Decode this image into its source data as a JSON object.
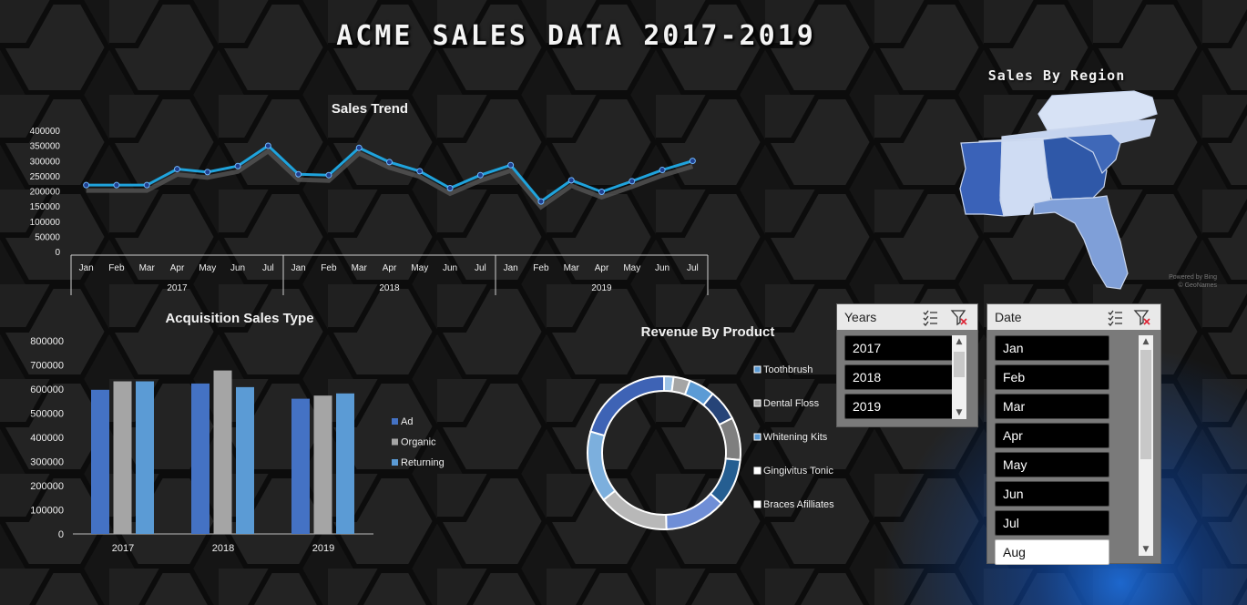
{
  "dashboard": {
    "title": "ACME SALES DATA 2017-2019"
  },
  "colors": {
    "background": "#151515",
    "line": "#1fa3dc",
    "point": "#1f3f8f",
    "ad": "#4472c4",
    "organic": "#a5a5a5",
    "returning": "#5b9bd5"
  },
  "sales_trend": {
    "chart_data": {
      "type": "line",
      "title": "Sales Trend",
      "xlabel": "",
      "ylabel": "",
      "ylim": [
        0,
        400000
      ],
      "yticks": [
        "400000",
        "350000",
        "300000",
        "250000",
        "200000",
        "150000",
        "100000",
        "50000",
        "0"
      ],
      "groups": [
        {
          "label": "2017",
          "months": [
            "Jan",
            "Feb",
            "Mar",
            "Apr",
            "May",
            "Jun",
            "Jul"
          ]
        },
        {
          "label": "2018",
          "months": [
            "Jan",
            "Feb",
            "Mar",
            "Apr",
            "May",
            "Jun",
            "Jul"
          ]
        },
        {
          "label": "2019",
          "months": [
            "Jan",
            "Feb",
            "Mar",
            "Apr",
            "May",
            "Jun",
            "Jul"
          ]
        }
      ],
      "values": [
        222000,
        222000,
        222000,
        275000,
        265000,
        285000,
        352000,
        258000,
        255000,
        345000,
        298000,
        268000,
        212000,
        255000,
        288000,
        168000,
        238000,
        200000,
        235000,
        272000,
        302000
      ]
    }
  },
  "acquisition": {
    "chart_data": {
      "type": "bar",
      "title": "Acquisition Sales Type",
      "categories": [
        "2017",
        "2018",
        "2019"
      ],
      "ylim": [
        0,
        800000
      ],
      "yticks": [
        "800000",
        "700000",
        "600000",
        "500000",
        "400000",
        "300000",
        "200000",
        "100000",
        "0"
      ],
      "series": [
        {
          "name": "Ad",
          "values": [
            597000,
            623000,
            560000
          ]
        },
        {
          "name": "Organic",
          "values": [
            632000,
            677000,
            573000
          ]
        },
        {
          "name": "Returning",
          "values": [
            632000,
            608000,
            582000
          ]
        }
      ],
      "legend_position": "right"
    }
  },
  "revenue": {
    "chart_data": {
      "type": "pie",
      "title": "Revenue By Product",
      "legend": [
        "Toothbrush",
        "Dental Floss",
        "Whitening Kits",
        "Gingivitus Tonic",
        "Braces Afilliates"
      ],
      "slices": [
        {
          "value": 2.0,
          "color": "#9dc3e6"
        },
        {
          "value": 3.5,
          "color": "#a5a5a5"
        },
        {
          "value": 5.5,
          "color": "#5b9bd5"
        },
        {
          "value": 6.5,
          "color": "#264478"
        },
        {
          "value": 9.0,
          "color": "#7f7f7f"
        },
        {
          "value": 10.0,
          "color": "#255e91"
        },
        {
          "value": 13.0,
          "color": "#6f8ed6"
        },
        {
          "value": 15.0,
          "color": "#b8b8b8"
        },
        {
          "value": 15.0,
          "color": "#7cafdd"
        },
        {
          "value": 20.5,
          "color": "#3e63b5"
        }
      ]
    }
  },
  "map": {
    "title": "Sales By Region",
    "credit_line1": "Powered by Bing",
    "credit_line2": "© GeoNames"
  },
  "years_slicer": {
    "header": "Years",
    "items": [
      "2017",
      "2018",
      "2019"
    ]
  },
  "date_slicer": {
    "header": "Date",
    "items": [
      "Jan",
      "Feb",
      "Mar",
      "Apr",
      "May",
      "Jun",
      "Jul",
      "Aug"
    ],
    "selected": "Aug"
  }
}
